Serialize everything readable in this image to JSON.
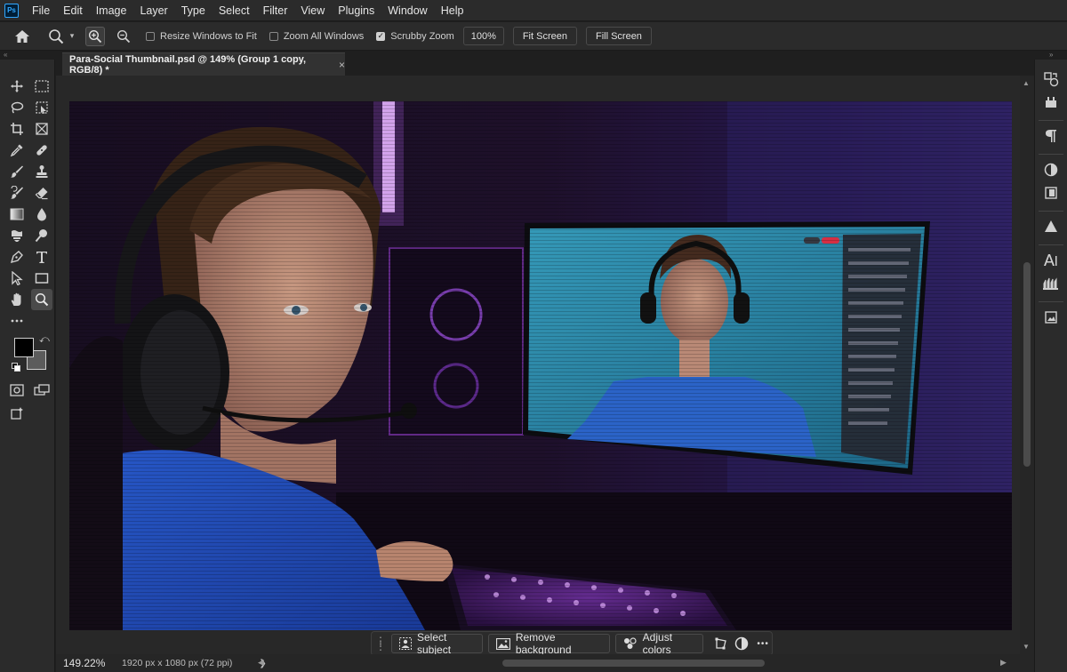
{
  "app": {
    "logo_text": "Ps"
  },
  "menu": [
    "File",
    "Edit",
    "Image",
    "Layer",
    "Type",
    "Select",
    "Filter",
    "View",
    "Plugins",
    "Window",
    "Help"
  ],
  "options": {
    "resize_windows": {
      "label": "Resize Windows to Fit",
      "checked": false
    },
    "zoom_all": {
      "label": "Zoom All Windows",
      "checked": false
    },
    "scrubby_zoom": {
      "label": "Scrubby Zoom",
      "checked": true
    },
    "zoom_value": "100%",
    "fit_screen": "Fit Screen",
    "fill_screen": "Fill Screen"
  },
  "document": {
    "tab_title": "Para-Social Thumbnail.psd @ 149% (Group 1 copy, RGB/8) *",
    "close_glyph": "×"
  },
  "taskbar": {
    "select_subject": "Select subject",
    "remove_background": "Remove background",
    "adjust_colors": "Adjust colors",
    "more": "•••"
  },
  "status": {
    "zoom": "149.22%",
    "doc_size": "1920 px x 1080 px (72 ppi)",
    "arrow": "❯"
  },
  "colors": {
    "foreground": "#000000",
    "background": "#5c5c5c",
    "accent": "#31a8ff"
  },
  "tools": [
    "move-tool-icon",
    "marquee-tool-icon",
    "lasso-tool-icon",
    "object-select-icon",
    "crop-tool-icon",
    "frame-tool-icon",
    "eyedropper-icon",
    "healing-brush-icon",
    "brush-tool-icon",
    "clone-stamp-icon",
    "history-brush-icon",
    "eraser-icon",
    "gradient-tool-icon",
    "blur-tool-icon",
    "dodge-tool-icon",
    "burn-tool-icon",
    "pen-tool-icon",
    "type-tool-icon",
    "path-select-icon",
    "rectangle-tool-icon",
    "hand-tool-icon",
    "zoom-tool-icon"
  ]
}
